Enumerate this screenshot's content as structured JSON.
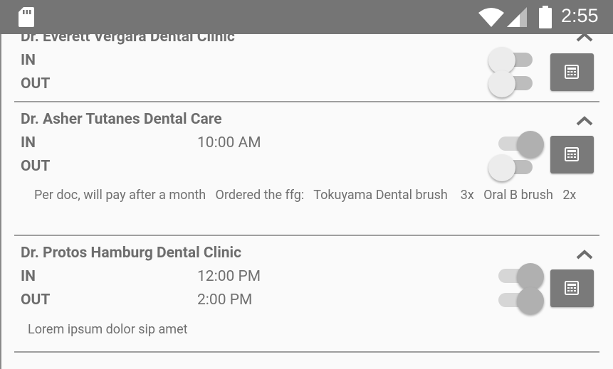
{
  "status_bar": {
    "time": "2:55",
    "icons": [
      "sd-card-icon",
      "wifi-icon",
      "signal-icon",
      "battery-icon"
    ]
  },
  "clinics": [
    {
      "name": "Dr. Everett Vergara Dental Clinic",
      "in_label": "IN",
      "in_time": "",
      "out_label": "OUT",
      "out_time": "",
      "in_toggle": false,
      "out_toggle": false,
      "expanded": true,
      "note": ""
    },
    {
      "name": "Dr. Asher Tutanes Dental Care",
      "in_label": "IN",
      "in_time": "10:00 AM",
      "out_label": "OUT",
      "out_time": "",
      "in_toggle": true,
      "out_toggle": false,
      "expanded": true,
      "note": "Per doc, will pay after a month   Ordered the ffg:   Tokuyama Dental brush    3x   Oral B brush   2x"
    },
    {
      "name": "Dr. Protos Hamburg Dental Clinic",
      "in_label": "IN",
      "in_time": "12:00 PM",
      "out_label": "OUT",
      "out_time": "2:00 PM",
      "in_toggle": true,
      "out_toggle": true,
      "expanded": true,
      "note": "Lorem ipsum dolor sip amet"
    }
  ],
  "colors": {
    "status_bar": "#757575",
    "button": "#7a7a7a",
    "text": "#6d6d6d"
  }
}
